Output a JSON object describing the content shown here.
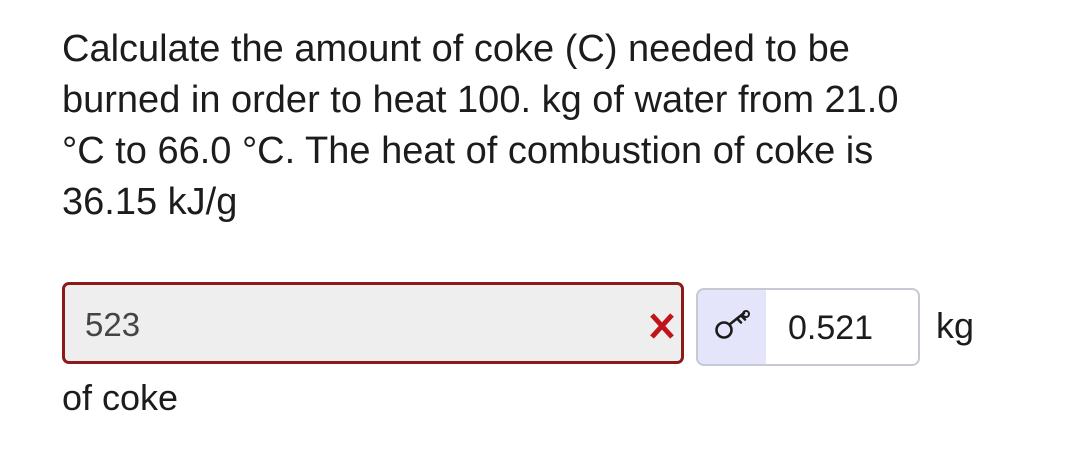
{
  "question": {
    "lines": [
      "Calculate the amount of coke (C) needed to be",
      "burned in order to heat 100. kg of water from 21.0",
      "°C to 66.0 °C. The heat of combustion of coke is",
      "36.15 kJ/g"
    ]
  },
  "answer": {
    "entered_value": "523",
    "status": "incorrect",
    "status_icon": "x-mark-icon",
    "status_color": "#c0141b",
    "border_color": "#8b1a1a",
    "correct_value": "0.521",
    "key_icon": "key-icon",
    "unit": "kg",
    "suffix": "of coke"
  }
}
